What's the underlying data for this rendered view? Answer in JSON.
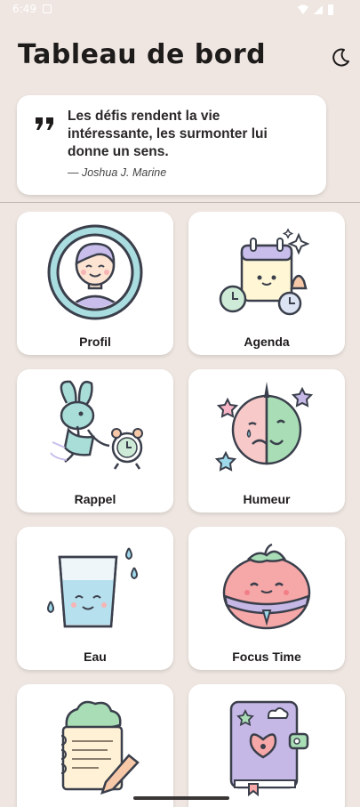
{
  "status_bar": {
    "time": "6:49"
  },
  "header": {
    "title": "Tableau de bord",
    "theme_icon": "moon-icon"
  },
  "quote": {
    "text": "Les défis rendent la vie intéressante, les surmonter lui donne un sens.",
    "author": "— Joshua J. Marine"
  },
  "tiles": [
    {
      "label": "Profil",
      "icon": "profile-avatar-icon"
    },
    {
      "label": "Agenda",
      "icon": "calendar-clock-icon"
    },
    {
      "label": "Rappel",
      "icon": "rabbit-alarm-icon"
    },
    {
      "label": "Humeur",
      "icon": "mood-face-icon"
    },
    {
      "label": "Eau",
      "icon": "water-glass-icon"
    },
    {
      "label": "Focus Time",
      "icon": "tomato-timer-icon"
    },
    {
      "label": "",
      "icon": "notepad-pencil-icon"
    },
    {
      "label": "",
      "icon": "diary-book-icon"
    }
  ],
  "colors": {
    "background": "#EFE6E1",
    "card": "#FFFFFF",
    "text": "#1E1B1B",
    "accent_teal": "#9ED8DB",
    "accent_pink": "#F29B9B",
    "accent_green": "#A8DDB5",
    "accent_purple": "#C6B8E6"
  }
}
